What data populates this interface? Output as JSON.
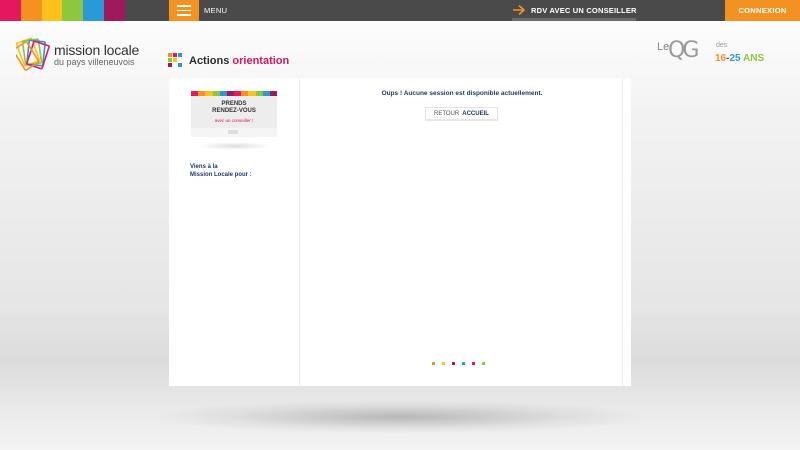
{
  "colors": {
    "swatches": [
      "#e5175f",
      "#f39220",
      "#fcc21b",
      "#8dc63f",
      "#2a9ad6",
      "#a1195d"
    ],
    "accent_orange": "#f39220",
    "accent_pink": "#d6175f",
    "navy": "#1e3a6a",
    "topbar": "#4a4a4a"
  },
  "topbar": {
    "menu_label": "MENU",
    "menu_icon": "hamburger-icon",
    "rdv_label": "RDV AVEC UN CONSEILLER",
    "rdv_icon": "arrow-right-icon",
    "connexion_label": "CONNEXION"
  },
  "logo": {
    "title": "mission locale",
    "subtitle": "du pays villeneuvois"
  },
  "page_header": {
    "title_part1": "Actions",
    "title_part2": "orientation"
  },
  "qg_logo": {
    "le": "Le",
    "qg": "QG",
    "des": "des",
    "age_a": "16",
    "age_dash": "-",
    "age_b": "25",
    "age_ans": "ANS"
  },
  "sidebar": {
    "rdv_card": {
      "title_line1": "PRENDS",
      "title_line2": "RENDEZ-VOUS",
      "subtitle": "avec un conseiller !"
    },
    "intro_line1": "Viens à la",
    "intro_line2": "Mission Locale pour :"
  },
  "content": {
    "message": "Oups ! Aucune session est disponible actuellement.",
    "back_button": {
      "prefix": "RETOUR",
      "strong": "ACCUEIL"
    },
    "pagination_dots": [
      "#f39220",
      "#fcc21b",
      "#a1195d",
      "#2a9ad6",
      "#e5175f",
      "#8dc63f"
    ]
  }
}
